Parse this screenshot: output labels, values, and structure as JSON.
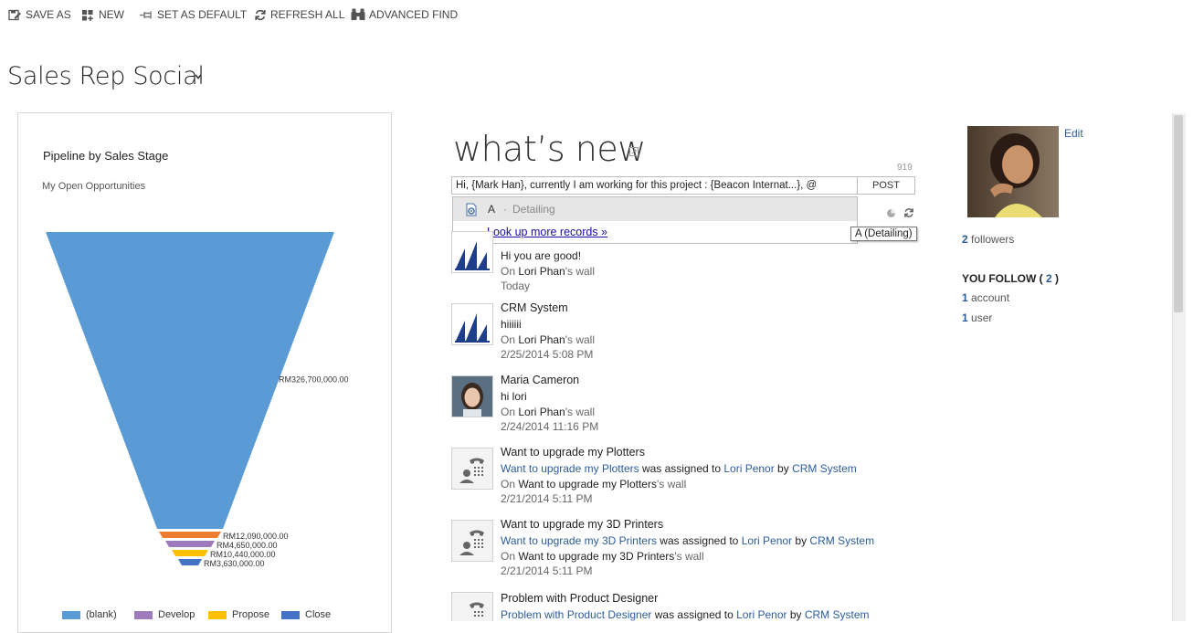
{
  "toolbar": {
    "save_as": "SAVE AS",
    "new": "NEW",
    "set_as_default": "SET AS DEFAULT",
    "refresh_all": "REFRESH ALL",
    "advanced_find": "ADVANCED FIND"
  },
  "page": {
    "title": "Sales Rep Social"
  },
  "chart_panel": {
    "chart_data": {
      "type": "funnel",
      "title": "Pipeline by Sales Stage",
      "subtitle": "My Open Opportunities",
      "categories": [
        "(blank)",
        "Develop",
        "Propose",
        "Close"
      ],
      "values": [
        326700000,
        12090000,
        4650000,
        10440000,
        3630000
      ],
      "value_labels": [
        "RM326,700,000.00",
        "RM12,090,000.00",
        "RM4,650,000.00",
        "RM10,440,000.00",
        "RM3,630,000.00"
      ],
      "segment_colors": [
        "#5b9bd5",
        "#ed7d31",
        "#9e7bbd",
        "#ffc000",
        "#4472c4"
      ],
      "legend": [
        {
          "label": "(blank)",
          "color": "#5b9bd5"
        },
        {
          "label": "Develop",
          "color": "#9e7bbd"
        },
        {
          "label": "Propose",
          "color": "#ffc000"
        },
        {
          "label": "Close",
          "color": "#4472c4"
        }
      ],
      "legend_position": "bottom"
    }
  },
  "whats_new": {
    "title": "what’s new",
    "char_count": "919",
    "post_text": "Hi, {Mark Han}, currently I am working for this project : {Beacon Internat...}, @",
    "post_button": "POST",
    "dropdown": {
      "item_letter": "A",
      "item_sep": "·",
      "item_detail": "Detailing",
      "more_link": "Look up more records »"
    },
    "tooltip": "A (Detailing)"
  },
  "feed": {
    "posts": [
      {
        "line2": "Hi you are good!",
        "on": "On ",
        "wall_owner": "Lori Phan",
        "wall_suffix": "'s wall",
        "time": "Today"
      },
      {
        "author": "CRM System",
        "line2": "hiiiiii",
        "on": "On ",
        "wall_owner": "Lori Phan",
        "wall_suffix": "'s wall",
        "time": "2/25/2014 5:08 PM"
      },
      {
        "author": "Maria Cameron",
        "line2": "hi lori",
        "on": "On ",
        "wall_owner": "Lori Phan",
        "wall_suffix": "'s wall",
        "time": "2/24/2014 11:16 PM"
      },
      {
        "author": "Want to upgrade my Plotters",
        "link1": "Want to upgrade my Plotters",
        "mid1": " was assigned to ",
        "link2": "Lori Penor",
        "mid2": " by ",
        "link3": "CRM System",
        "on": "On ",
        "wall_owner": "Want to upgrade my Plotters",
        "wall_suffix": "'s wall",
        "time": "2/21/2014 5:11 PM"
      },
      {
        "author": "Want to upgrade my 3D Printers",
        "link1": "Want to upgrade my 3D Printers",
        "mid1": " was assigned to ",
        "link2": "Lori Penor",
        "mid2": " by ",
        "link3": "CRM System",
        "on": "On ",
        "wall_owner": "Want to upgrade my 3D Printers",
        "wall_suffix": "'s wall",
        "time": "2/21/2014 5:11 PM"
      },
      {
        "author": "Problem with Product Designer",
        "link1": "Problem with Product Designer",
        "mid1": " was assigned to ",
        "link2": "Lori Penor",
        "mid2": " by ",
        "link3": "CRM System"
      }
    ]
  },
  "profile": {
    "edit": "Edit",
    "followers_count": "2",
    "followers_label": " followers",
    "you_follow_label": "YOU FOLLOW",
    "you_follow_open": " ( ",
    "you_follow_count": "2",
    "you_follow_close": " )",
    "follow_items": [
      {
        "count": "1",
        "label": " account"
      },
      {
        "count": "1",
        "label": " user"
      }
    ]
  }
}
